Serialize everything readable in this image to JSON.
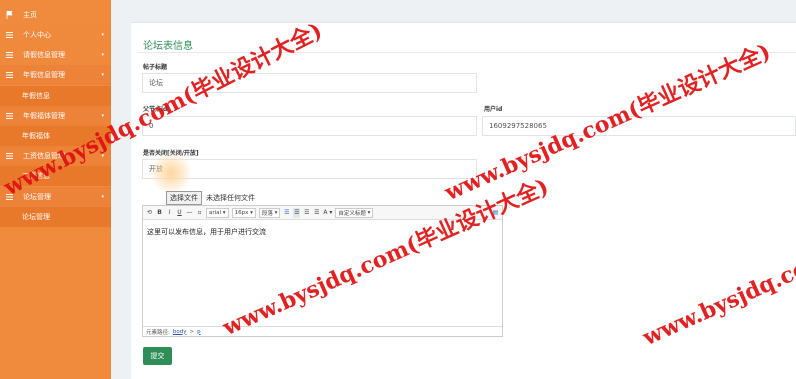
{
  "sidebar": {
    "items": [
      {
        "label": "主页",
        "icon": "flag-icon",
        "chevron": ""
      },
      {
        "label": "个人中心",
        "icon": "list-icon",
        "chevron": "▾"
      },
      {
        "label": "请假信息管理",
        "icon": "list-icon",
        "chevron": "▾"
      },
      {
        "label": "年假信息管理",
        "icon": "list-icon",
        "chevron": "▾"
      },
      {
        "label": "年假信息",
        "icon": "",
        "chevron": ""
      },
      {
        "label": "年假福体管理",
        "icon": "list-icon",
        "chevron": "▾"
      },
      {
        "label": "年假福体",
        "icon": "",
        "chevron": ""
      },
      {
        "label": "工资信息管理",
        "icon": "list-icon",
        "chevron": "▾"
      },
      {
        "label": "工资信息",
        "icon": "",
        "chevron": ""
      },
      {
        "label": "论坛管理",
        "icon": "list-icon",
        "chevron": "▾"
      },
      {
        "label": "论坛管理",
        "icon": "",
        "chevron": ""
      }
    ]
  },
  "form": {
    "title": "论坛表信息",
    "post_title_label": "帖子标题",
    "post_title_value": "论坛",
    "parent_id_label": "父节点id",
    "parent_id_value": "0",
    "user_id_label": "用户id",
    "user_id_value": "1609297528065",
    "open_status_label": "是否关闭[关闭/开放]",
    "open_status_value": "开放",
    "file_button": "选择文件",
    "file_status": "未选择任何文件",
    "editor_content": "这里可以发布信息，用于用户进行交流",
    "editor_footer_label": "元素路径:",
    "editor_footer_body": "body",
    "editor_footer_sep": ">",
    "editor_footer_p": "p",
    "submit_label": "提交"
  },
  "toolbar": {
    "font": "arial",
    "size": "16px",
    "para": "段落",
    "custom": "自定义标题"
  },
  "watermark": "www.bysjdq.com(毕业设计大全)",
  "colors": {
    "sidebar": "#f08a3c",
    "accent": "#2d8f57",
    "watermark": "#e01010"
  }
}
